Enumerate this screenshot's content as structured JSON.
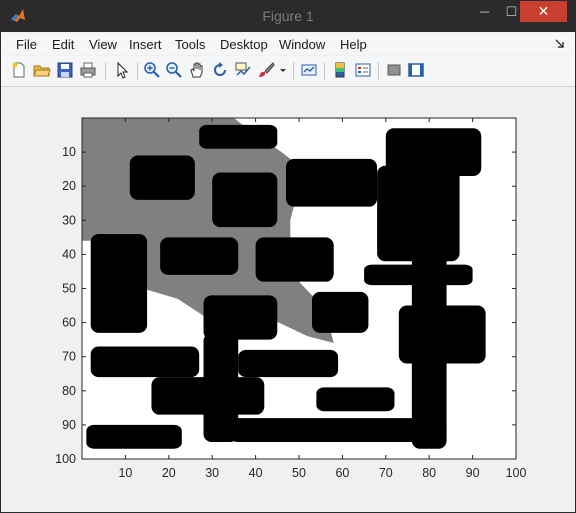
{
  "window": {
    "title": "Figure 1",
    "minimize_glyph": "─",
    "maximize_glyph": "☐",
    "close_glyph": "✕"
  },
  "menu": {
    "items": [
      "File",
      "Edit",
      "View",
      "Insert",
      "Tools",
      "Desktop",
      "Window",
      "Help"
    ]
  },
  "toolbar": {
    "icons": [
      "new-figure-icon",
      "open-file-icon",
      "save-icon",
      "print-icon",
      "edit-plot-arrow-icon",
      "zoom-in-icon",
      "zoom-out-icon",
      "pan-hand-icon",
      "rotate-3d-icon",
      "data-cursor-icon",
      "brush-icon",
      "brush-dropdown-icon",
      "link-plot-icon",
      "insert-colorbar-icon",
      "insert-legend-icon",
      "hide-plot-tools-icon",
      "show-plot-tools-icon"
    ]
  },
  "colors": {
    "obstacle": "#000000",
    "explored": "#808080",
    "free": "#ffffff",
    "close_button": "#c7402f"
  },
  "chart_data": {
    "type": "heatmap",
    "title": "",
    "xlabel": "",
    "ylabel": "",
    "xlim": [
      0,
      100
    ],
    "ylim": [
      100,
      0
    ],
    "xticks": [
      10,
      20,
      30,
      40,
      50,
      60,
      70,
      80,
      90,
      100
    ],
    "yticks": [
      10,
      20,
      30,
      40,
      50,
      60,
      70,
      80,
      90,
      100
    ],
    "grid": false,
    "colormap": "gray",
    "explored_region": [
      [
        0,
        0
      ],
      [
        35,
        0
      ],
      [
        37,
        2
      ],
      [
        46,
        10
      ],
      [
        50,
        14
      ],
      [
        50,
        20
      ],
      [
        48,
        30
      ],
      [
        48,
        40
      ],
      [
        50,
        48
      ],
      [
        56,
        56
      ],
      [
        58,
        66
      ],
      [
        52,
        64
      ],
      [
        42,
        58
      ],
      [
        28,
        58
      ],
      [
        22,
        53
      ],
      [
        14,
        50
      ],
      [
        14,
        44
      ],
      [
        10,
        36
      ],
      [
        0,
        36
      ]
    ],
    "obstacles": [
      {
        "x": [
          27,
          45
        ],
        "y": [
          2,
          9
        ]
      },
      {
        "x": [
          70,
          92
        ],
        "y": [
          3,
          17
        ]
      },
      {
        "x": [
          11,
          26
        ],
        "y": [
          11,
          24
        ]
      },
      {
        "x": [
          47,
          68
        ],
        "y": [
          12,
          26
        ]
      },
      {
        "x": [
          30,
          45
        ],
        "y": [
          16,
          32
        ]
      },
      {
        "x": [
          68,
          87
        ],
        "y": [
          14,
          42
        ]
      },
      {
        "x": [
          2,
          15
        ],
        "y": [
          34,
          63
        ]
      },
      {
        "x": [
          18,
          36
        ],
        "y": [
          35,
          46
        ]
      },
      {
        "x": [
          40,
          58
        ],
        "y": [
          35,
          48
        ]
      },
      {
        "x": [
          65,
          90
        ],
        "y": [
          43,
          49
        ]
      },
      {
        "x": [
          76,
          84
        ],
        "y": [
          14,
          97
        ]
      },
      {
        "x": [
          28,
          45
        ],
        "y": [
          52,
          65
        ]
      },
      {
        "x": [
          53,
          66
        ],
        "y": [
          51,
          63
        ]
      },
      {
        "x": [
          73,
          93
        ],
        "y": [
          55,
          72
        ]
      },
      {
        "x": [
          2,
          27
        ],
        "y": [
          67,
          76
        ]
      },
      {
        "x": [
          36,
          59
        ],
        "y": [
          68,
          76
        ]
      },
      {
        "x": [
          28,
          36
        ],
        "y": [
          63,
          95
        ]
      },
      {
        "x": [
          16,
          42
        ],
        "y": [
          76,
          87
        ]
      },
      {
        "x": [
          54,
          72
        ],
        "y": [
          79,
          86
        ]
      },
      {
        "x": [
          34,
          84
        ],
        "y": [
          88,
          95
        ]
      },
      {
        "x": [
          1,
          23
        ],
        "y": [
          90,
          97
        ]
      }
    ]
  }
}
